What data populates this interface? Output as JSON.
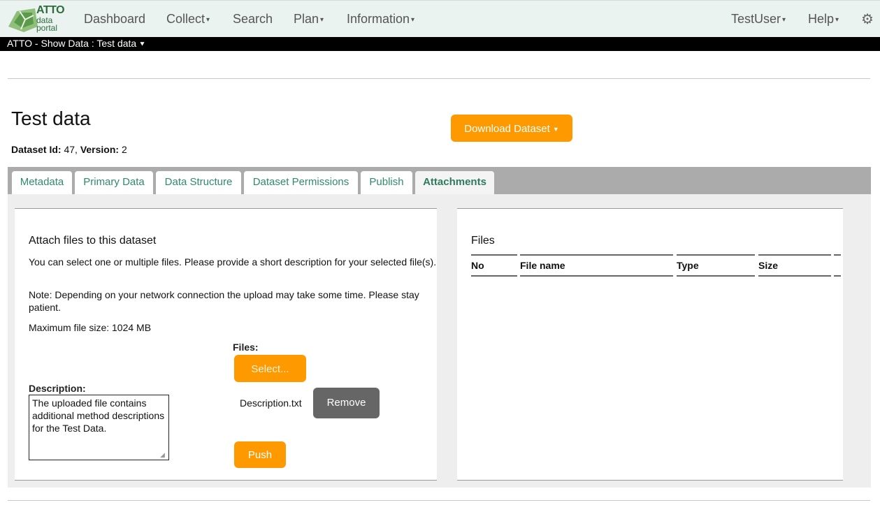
{
  "nav": {
    "logo": {
      "line1": "ATTO",
      "line2": "data",
      "line3": "portal"
    },
    "items": [
      "Dashboard",
      "Collect",
      "Search",
      "Plan",
      "Information"
    ],
    "user": "TestUser",
    "help": "Help",
    "gear_icon": "gear-icon"
  },
  "breadcrumb": "ATTO - Show Data : Test data",
  "dataset": {
    "title": "Test data",
    "id_label": "Dataset Id:",
    "id_value": "47",
    "version_label": "Version:",
    "version_value": "2",
    "download_label": "Download Dataset"
  },
  "tabs": [
    "Metadata",
    "Primary Data",
    "Data Structure",
    "Dataset Permissions",
    "Publish",
    "Attachments"
  ],
  "active_tab": "Attachments",
  "attach": {
    "title": "Attach files to this dataset",
    "p1": "You can select one or multiple files. Please provide a short description for your selected file(s).",
    "p2": "Note: Depending on your network connection the upload may take some time. Please stay patient.",
    "p3": "Maximum file size: 1024 MB",
    "files_label": "Files:",
    "select_label": "Select...",
    "description_label": "Description:",
    "description_value": "The uploaded file contains additional method descriptions for the Test Data.",
    "selected_file": "Description.txt",
    "remove_label": "Remove",
    "push_label": "Push"
  },
  "files_table": {
    "title": "Files",
    "columns": [
      "No",
      "File name",
      "Type",
      "Size"
    ]
  },
  "colors": {
    "accent": "#ff9900",
    "tab_text": "#2e8b6a",
    "nav_bg": "#eaf3ef"
  }
}
